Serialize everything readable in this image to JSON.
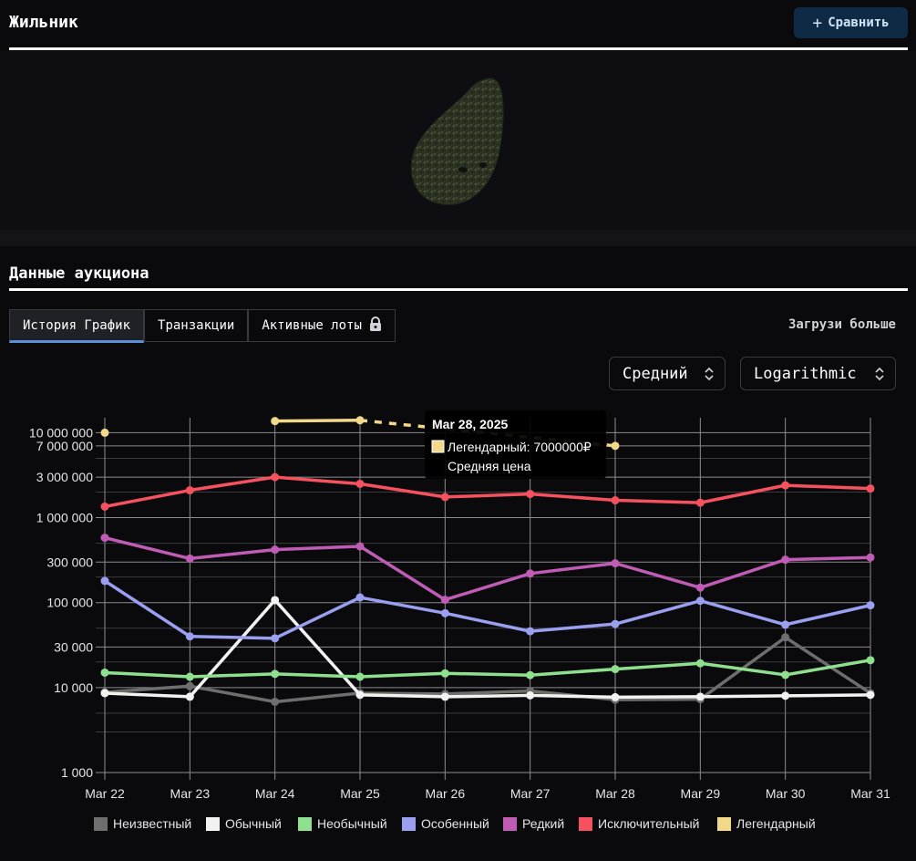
{
  "item": {
    "title": "Жильник",
    "compare_label": "Сравнить"
  },
  "section": {
    "title": "Данные аукциона"
  },
  "tabs": [
    {
      "label": "История График",
      "active": true
    },
    {
      "label": "Транзакции",
      "active": false
    },
    {
      "label": "Активные лоты",
      "active": false,
      "locked": true
    }
  ],
  "load_more": "Загрузи больше",
  "selects": {
    "aggregate": "Средний",
    "scale": "Logarithmic"
  },
  "tooltip": {
    "title": "Mar 28, 2025",
    "line1": "Легендарный: 7000000₽",
    "line2": "Средняя цена",
    "swatch_color": "#f2d98a"
  },
  "chart_data": {
    "type": "line",
    "categories": [
      "Mar 22",
      "Mar 23",
      "Mar 24",
      "Mar 25",
      "Mar 26",
      "Mar 27",
      "Mar 28",
      "Mar 29",
      "Mar 30",
      "Mar 31"
    ],
    "yscale": "log",
    "ylim": [
      1000,
      15000000
    ],
    "ytick_values": [
      1000,
      10000,
      30000,
      100000,
      300000,
      1000000,
      3000000,
      7000000,
      10000000
    ],
    "ytick_labels": [
      "1 000",
      "10 000",
      "30 000",
      "100 000",
      "300 000",
      "1 000 000",
      "3 000 000",
      "7 000 000",
      "10 000 000"
    ],
    "grid": true,
    "legend_position": "bottom",
    "series": [
      {
        "name": "Неизвестный",
        "color": "#6e6e6e",
        "values": [
          8800,
          10400,
          6800,
          8600,
          8400,
          9100,
          7200,
          7300,
          39000,
          8600
        ]
      },
      {
        "name": "Обычный",
        "color": "#f2f2f2",
        "values": [
          8600,
          7800,
          107000,
          8200,
          7800,
          8100,
          7700,
          7800,
          8000,
          8200
        ]
      },
      {
        "name": "Необычный",
        "color": "#8ee08e",
        "values": [
          15000,
          13400,
          14500,
          13400,
          14700,
          14000,
          16500,
          19300,
          14100,
          21000
        ]
      },
      {
        "name": "Особенный",
        "color": "#9a9ff0",
        "values": [
          180000,
          40000,
          38000,
          115000,
          75000,
          46000,
          56000,
          105000,
          55000,
          93000
        ]
      },
      {
        "name": "Редкий",
        "color": "#c05cb6",
        "values": [
          580000,
          330000,
          420000,
          460000,
          108000,
          220000,
          290000,
          150000,
          320000,
          340000
        ]
      },
      {
        "name": "Исключительный",
        "color": "#f5515f",
        "values": [
          1350000,
          2100000,
          3000000,
          2500000,
          1750000,
          1900000,
          1600000,
          1500000,
          2400000,
          2200000
        ]
      },
      {
        "name": "Легендарный",
        "color": "#f2d98a",
        "values": [
          10000000,
          null,
          13700000,
          14000000,
          null,
          null,
          7000000,
          null,
          null,
          null
        ],
        "gap_segment": [
          3,
          6
        ]
      }
    ]
  }
}
